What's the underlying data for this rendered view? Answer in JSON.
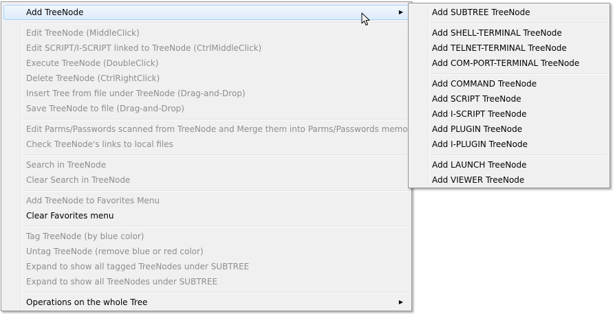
{
  "main_menu": {
    "add_treenode": "Add TreeNode",
    "edit_treenode": "Edit TreeNode (MiddleClick)",
    "edit_script": "Edit SCRIPT/I-SCRIPT linked to TreeNode (CtrlMiddleClick)",
    "execute_treenode": "Execute TreeNode (DoubleClick)",
    "delete_treenode": "Delete TreeNode (CtrlRightClick)",
    "insert_tree": "Insert Tree from file under TreeNode (Drag-and-Drop)",
    "save_treenode": "Save TreeNode to file (Drag-and-Drop)",
    "edit_parms": "Edit Parms/Passwords scanned from TreeNode and Merge them into Parms/Passwords memory",
    "check_links": "Check TreeNode's links to local files",
    "search": "Search in TreeNode",
    "clear_search": "Clear Search in TreeNode",
    "add_favorites": "Add TreeNode to Favorites Menu",
    "clear_favorites": "Clear Favorites menu",
    "tag_treenode": "Tag TreeNode (by blue color)",
    "untag_treenode": "Untag TreeNode (remove blue or red color)",
    "expand_tagged": "Expand to show all tagged TreeNodes under SUBTREE",
    "expand_all": "Expand to show all TreeNodes under SUBTREE",
    "operations_tree": "Operations on the whole Tree",
    "submenu_arrow": "▶"
  },
  "sub_menu": {
    "add_subtree": "Add SUBTREE TreeNode",
    "add_shell": "Add SHELL-TERMINAL TreeNode",
    "add_telnet": "Add TELNET-TERMINAL TreeNode",
    "add_comport": "Add COM-PORT-TERMINAL TreeNode",
    "add_command": "Add COMMAND TreeNode",
    "add_script": "Add SCRIPT TreeNode",
    "add_iscript": "Add I-SCRIPT TreeNode",
    "add_plugin": "Add PLUGIN TreeNode",
    "add_iplugin": "Add I-PLUGIN TreeNode",
    "add_launch": "Add LAUNCH TreeNode",
    "add_viewer": "Add VIEWER TreeNode"
  },
  "icons": {
    "submenu_arrow": "chevron-right-icon",
    "cursor": "mouse-pointer-icon"
  },
  "colors": {
    "menu_bg": "#f0f0f0",
    "disabled_text": "#8d8d8d",
    "hover_border": "#a8d2fd",
    "hover_bg": "#dcebfc"
  }
}
